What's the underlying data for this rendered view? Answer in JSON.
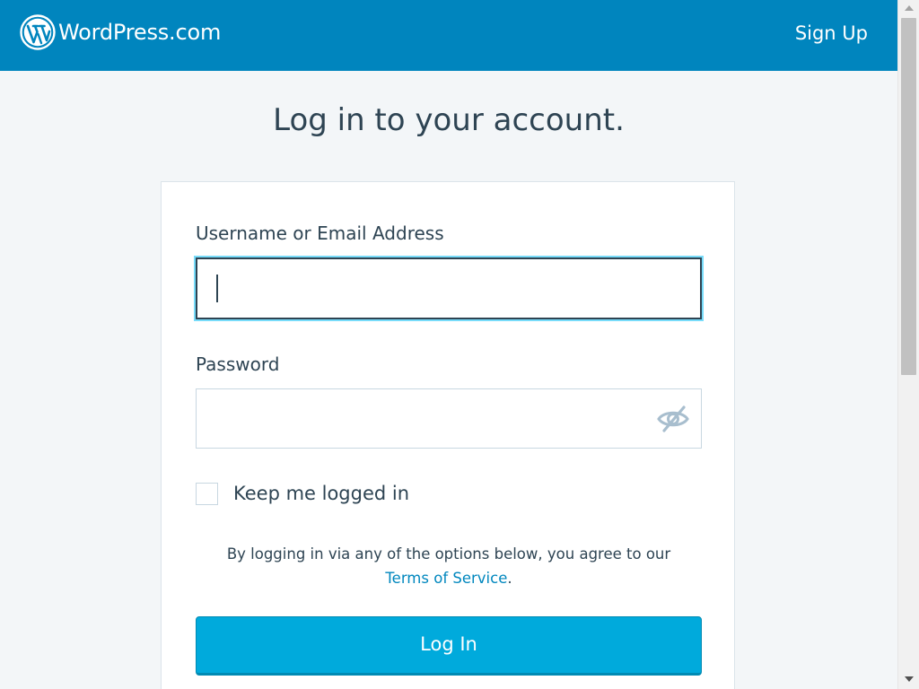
{
  "header": {
    "brand": "WordPress.com",
    "signup_label": "Sign Up",
    "background_color": "#0085be"
  },
  "page": {
    "heading": "Log in to your account."
  },
  "form": {
    "username_label": "Username or Email Address",
    "username_value": "",
    "password_label": "Password",
    "password_value": "",
    "remember_label": "Keep me logged in",
    "remember_checked": false,
    "tos_text": "By logging in via any of the options below, you agree to our",
    "tos_link": "Terms of Service",
    "tos_period": ".",
    "login_label": "Log In",
    "login_color": "#00aadc",
    "link_color": "#0087be",
    "text_color": "#2e4453"
  },
  "icons": {
    "logo": "wordpress-logo-icon",
    "password_toggle": "eye-hidden-icon"
  }
}
